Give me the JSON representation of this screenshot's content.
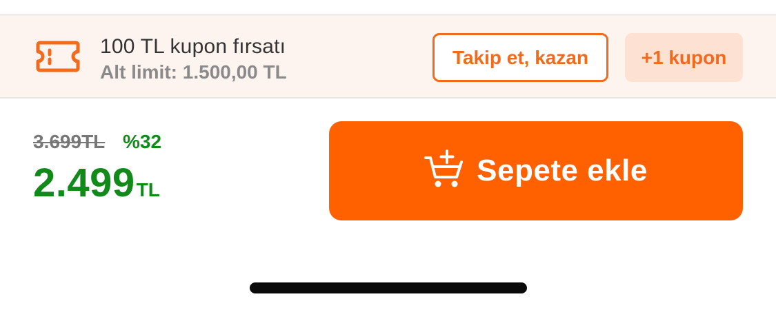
{
  "coupon": {
    "icon": "ticket-icon",
    "title": "100 TL kupon fırsatı",
    "subtitle": "Alt limit: 1.500,00 TL",
    "follow_button": "Takip et, kazan",
    "more_button": "+1 kupon",
    "accent_color": "#f26a1b",
    "background_color": "#fef4ef"
  },
  "pricing": {
    "old_price": "3.699TL",
    "discount": "%32",
    "price": "2.499",
    "currency": "TL",
    "price_color": "#118a1a"
  },
  "cart": {
    "icon": "cart-add-icon",
    "button_label": "Sepete ekle",
    "button_color": "#ff6000"
  }
}
